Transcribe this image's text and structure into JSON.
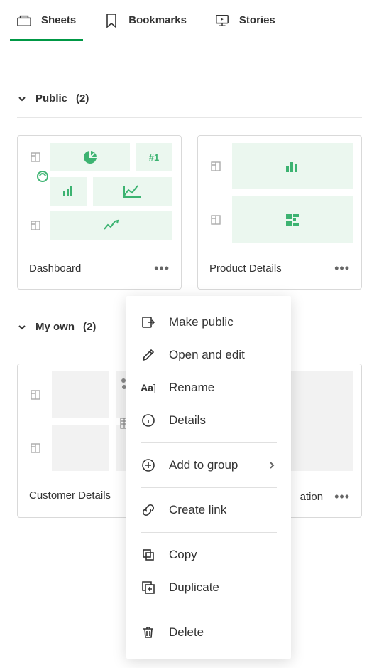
{
  "tabs": {
    "sheets": "Sheets",
    "bookmarks": "Bookmarks",
    "stories": "Stories"
  },
  "sections": {
    "public": {
      "label": "Public",
      "count": "(2)"
    },
    "myown": {
      "label": "My own",
      "count": "(2)"
    }
  },
  "cards": {
    "dashboard": {
      "title": "Dashboard",
      "hashtag": "#1"
    },
    "product": {
      "title": "Product Details"
    },
    "customer": {
      "title": "Customer Details"
    },
    "other": {
      "title_suffix": "ation"
    }
  },
  "menu": {
    "make_public": "Make public",
    "open_edit": "Open and edit",
    "rename": "Rename",
    "details": "Details",
    "add_group": "Add to group",
    "create_link": "Create link",
    "copy": "Copy",
    "duplicate": "Duplicate",
    "delete": "Delete"
  },
  "colors": {
    "accent": "#009845",
    "thumb_green": "#3cb371"
  }
}
